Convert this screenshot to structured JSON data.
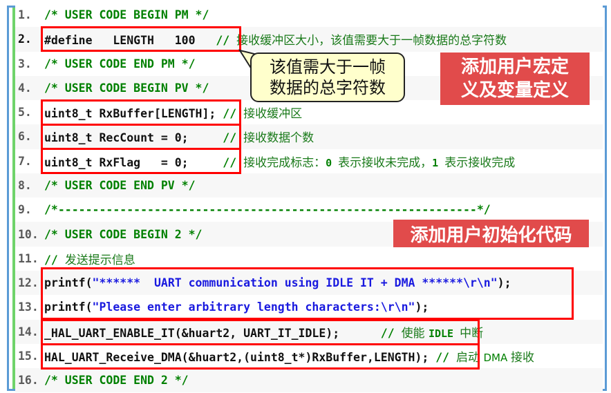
{
  "colors": {
    "frame_border": "#5b9bd5",
    "gutter": "#6fd36a",
    "comment": "#008000",
    "string": "#1a1adf",
    "highlight_box": "#ff0000",
    "tag_background": "#e14b4b",
    "callout_background": "#ffffcc"
  },
  "lines": [
    {
      "num": "1.",
      "parts": [
        {
          "t": "/* USER CODE BEGIN PM */",
          "c": "cmt"
        }
      ]
    },
    {
      "num": "2.",
      "parts": [
        {
          "t": "#define   LENGTH   100",
          "c": "code"
        },
        {
          "t": "   // ",
          "c": "cmt"
        },
        {
          "t": "接收缓冲区大小，该值需要大于一帧数据的总字符数",
          "c": "cn"
        }
      ]
    },
    {
      "num": "3.",
      "parts": [
        {
          "t": "/* USER CODE END PM */",
          "c": "cmt"
        }
      ]
    },
    {
      "num": "4.",
      "parts": [
        {
          "t": "/* USER CODE BEGIN PV */",
          "c": "cmt"
        }
      ]
    },
    {
      "num": "5.",
      "parts": [
        {
          "t": "uint8_t RxBuffer[LENGTH];",
          "c": "code"
        },
        {
          "t": " // ",
          "c": "cmt"
        },
        {
          "t": "接收缓冲区",
          "c": "cn"
        }
      ]
    },
    {
      "num": "6.",
      "parts": [
        {
          "t": "uint8_t RecCount = 0;",
          "c": "code"
        },
        {
          "t": "     // ",
          "c": "cmt"
        },
        {
          "t": "接收数据个数",
          "c": "cn"
        }
      ]
    },
    {
      "num": "7.",
      "parts": [
        {
          "t": "uint8_t RxFlag   = 0;",
          "c": "code"
        },
        {
          "t": "     // ",
          "c": "cmt"
        },
        {
          "t": "接收完成标志：",
          "c": "cn"
        },
        {
          "t": "0 ",
          "c": "cn-mono"
        },
        {
          "t": "表示接收未完成，",
          "c": "cn"
        },
        {
          "t": "1 ",
          "c": "cn-mono"
        },
        {
          "t": "表示接收完成",
          "c": "cn"
        }
      ]
    },
    {
      "num": "8.",
      "parts": [
        {
          "t": "/* USER CODE END PV */",
          "c": "cmt"
        }
      ]
    },
    {
      "num": "9.",
      "parts": [
        {
          "t": "/*-------------------------------------------------------------*/",
          "c": "cmt"
        }
      ]
    },
    {
      "num": "10.",
      "parts": [
        {
          "t": "/* USER CODE BEGIN 2 */",
          "c": "cmt"
        }
      ]
    },
    {
      "num": "11.",
      "parts": [
        {
          "t": "// ",
          "c": "cmt"
        },
        {
          "t": "发送提示信息",
          "c": "cn"
        }
      ]
    },
    {
      "num": "12.",
      "parts": [
        {
          "t": "printf(",
          "c": "code"
        },
        {
          "t": "\"******  UART communication using IDLE IT + DMA ******\\r\\n\"",
          "c": "str"
        },
        {
          "t": ");",
          "c": "code"
        }
      ]
    },
    {
      "num": "13.",
      "parts": [
        {
          "t": "printf(",
          "c": "code"
        },
        {
          "t": "\"Please enter arbitrary length characters:\\r\\n\"",
          "c": "str"
        },
        {
          "t": ");",
          "c": "code"
        }
      ]
    },
    {
      "num": "14.",
      "parts": [
        {
          "t": "_HAL_UART_ENABLE_IT(&huart2, UART_IT_IDLE);",
          "c": "code"
        },
        {
          "t": "      // ",
          "c": "cmt"
        },
        {
          "t": "使能 ",
          "c": "cn"
        },
        {
          "t": "IDLE ",
          "c": "cn-mono"
        },
        {
          "t": "中断",
          "c": "cn"
        }
      ]
    },
    {
      "num": "15.",
      "parts": [
        {
          "t": "HAL_UART_Receive_DMA(&huart2,(uint8_t*)RxBuffer,LENGTH);",
          "c": "code"
        },
        {
          "t": " // ",
          "c": "cmt"
        },
        {
          "t": "启动 ",
          "c": "cn"
        },
        {
          "t": "DMA ",
          "c": "cn-sans"
        },
        {
          "t": "接收",
          "c": "cn"
        }
      ]
    },
    {
      "num": "16.",
      "parts": [
        {
          "t": "/* USER CODE END 2 */",
          "c": "cmt"
        }
      ]
    }
  ],
  "callout": {
    "line1": "该值需大于一帧",
    "line2": "数据的总字符数"
  },
  "tags": {
    "macro_vars_line1": "添加用户宏定",
    "macro_vars_line2": "义及变量定义",
    "init_code": "添加用户初始化代码"
  }
}
